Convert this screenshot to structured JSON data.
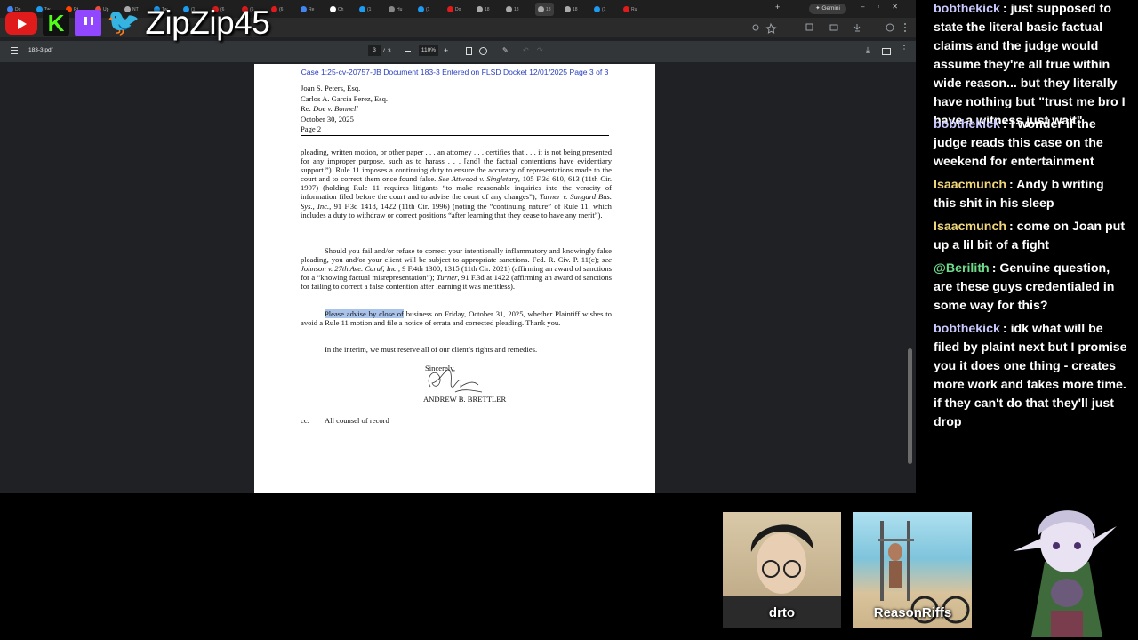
{
  "overlay": {
    "channel_name": "ZipZip45"
  },
  "browser": {
    "tabs": [
      "Do",
      "Tw",
      "Rt",
      "Up",
      "NT",
      "Tw",
      "(1",
      "(6",
      "(6",
      "(6",
      "Re",
      "Ch",
      "(1",
      "Hu",
      "(1",
      "Do",
      "18",
      "18",
      "18",
      "18",
      "(1",
      "Ru"
    ],
    "gemini_label": "Gemini"
  },
  "pdf": {
    "filename": "183-3.pdf",
    "page_current": "3",
    "page_total": "3",
    "zoom": "110%"
  },
  "document": {
    "header": "Case 1:25-cv-20757-JB   Document 183-3   Entered on FLSD Docket 12/01/2025   Page 3 of 3",
    "addressee": [
      "Joan S. Peters, Esq.",
      "Carlos A. Garcia Perez, Esq."
    ],
    "re_label": "Re:",
    "re_case": "Doe v. Bonnell",
    "date": "October 30, 2025",
    "page_label": "Page 2",
    "para1": "pleading, written motion, or other paper . . . an attorney . . . certifies that . . . it is not being presented for any improper purpose, such as to harass . . . [and] the factual contentions have evidentiary support.”). Rule 11 imposes a continuing duty to ensure the accuracy of representations made to the court and to correct them once found false. ",
    "para1_cite1": "See Attwood v. Singletary",
    "para1_b": ", 105 F.3d 610, 613 (11th Cir. 1997) (holding Rule 11 requires litigants “to make reasonable inquiries into the veracity of information filed before the court and to advise the court of any changes”); ",
    "para1_cite2": "Turner v. Sungard Bus. Sys., Inc.",
    "para1_c": ", 91 F.3d 1418, 1422 (11th Cir. 1996) (noting the “continuing nature” of Rule 11, which includes a duty to withdraw or correct positions “after learning that they cease to have any merit”).",
    "para2_a": "Should you fail and/or refuse to correct your intentionally inflammatory and knowingly false pleading, you and/or your client will be subject to appropriate sanctions. Fed. R. Civ. P. 11(c); ",
    "para2_cite1": "see Johnson v. 27th Ave. Caraf, Inc.",
    "para2_b": ", 9 F.4th 1300, 1315 (11th Cir. 2021) (affirming an award of sanctions for a “knowing factual misrepresentation”); ",
    "para2_cite2": "Turner",
    "para2_c": ", 91 F.3d at 1422 (affirming an award of sanctions for failing to correct a false contention after learning it was meritless).",
    "para3_highlight": "Please advise by close of",
    "para3_rest": " business on Friday, October 31, 2025, whether Plaintiff wishes to avoid a Rule 11 motion and file a notice of errata and corrected pleading. Thank you.",
    "para4": "In the interim, we must reserve all of our client’s rights and remedies.",
    "closing": "Sincerely,",
    "signer": "ANDREW B. BRETTLER",
    "cc_label": "cc:",
    "cc_value": "All counsel of record"
  },
  "chat": {
    "messages": [
      {
        "user": "bobthekick",
        "color": "#c9c9ff",
        "text": ": just supposed to state the literal basic factual claims and the judge would assume they're all true within wide reason... but they literally have nothing but \"trust me bro I have a witness just wait\""
      },
      {
        "user": "bobthekick",
        "color": "#c9c9ff",
        "text": ": I wonder if the judge reads this case on the weekend for entertainment"
      },
      {
        "user": "Isaacmunch",
        "color": "#f0d67a",
        "text": ": Andy b writing this shit in his sleep"
      },
      {
        "user": "Isaacmunch",
        "color": "#f0d67a",
        "text": ": come on Joan put up a lil bit of a fight"
      },
      {
        "user": "@Berilith",
        "color": "#6fdc8c",
        "text": ": Genuine question, are these guys credentialed in some way for this?"
      },
      {
        "user": "bobthekick",
        "color": "#c9c9ff",
        "text": ": idk what will be filed by plaint next but I promise you it does one thing - creates more work and takes more time. if they can't do that they'll just drop"
      }
    ]
  },
  "cams": [
    {
      "name": "drto"
    },
    {
      "name": "ReasonRiffs"
    }
  ]
}
